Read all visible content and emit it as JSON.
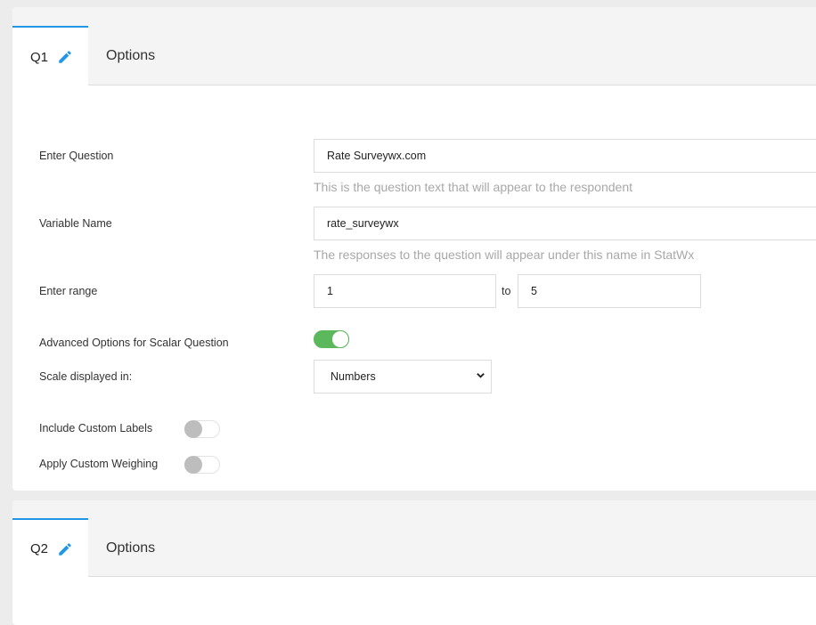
{
  "questions": [
    {
      "tab_label": "Q1",
      "options_tab_label": "Options",
      "enter_question": {
        "label": "Enter Question",
        "value": "Rate Surveywx.com",
        "help": "This is the question text that will appear to the respondent"
      },
      "variable_name": {
        "label": "Variable Name",
        "value": "rate_surveywx",
        "help": "The responses to the question will appear under this name in StatWx"
      },
      "range": {
        "label": "Enter range",
        "from": "1",
        "to_label": "to",
        "to": "5"
      },
      "advanced_options": {
        "label": "Advanced Options for Scalar Question",
        "enabled": true
      },
      "scale_displayed": {
        "label": "Scale displayed in:",
        "selected": "Numbers"
      },
      "include_custom_labels": {
        "label": "Include Custom Labels",
        "enabled": false
      },
      "apply_custom_weighing": {
        "label": "Apply Custom Weighing",
        "enabled": false
      }
    },
    {
      "tab_label": "Q2",
      "options_tab_label": "Options"
    }
  ],
  "colors": {
    "accent": "#2196e6",
    "toggle_on": "#5cb85c",
    "toggle_off_knob": "#bdbdbd",
    "help_text": "#a8a8a8"
  }
}
